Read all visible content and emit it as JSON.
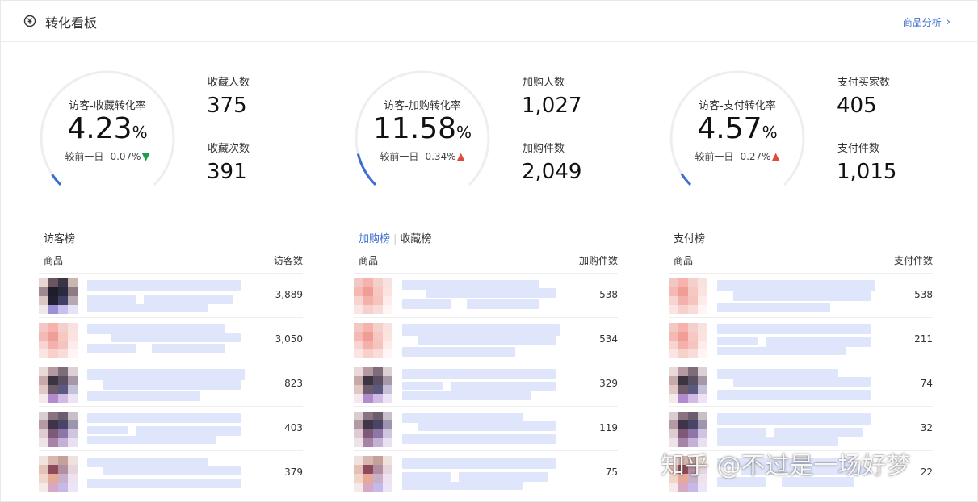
{
  "header": {
    "title": "转化看板",
    "link_label": "商品分析",
    "icon": "yuan-circle-icon"
  },
  "sections": [
    {
      "gauge_label": "访客-收藏转化率",
      "rate": "4.23",
      "rate_unit": "%",
      "rate_fraction": 0.0423,
      "compare_label": "较前一日",
      "compare_value": "0.07%",
      "trend": "down",
      "stat1_label": "收藏人数",
      "stat1_value": "375",
      "stat2_label": "收藏次数",
      "stat2_value": "391",
      "tabs": [
        "访客榜"
      ],
      "col_product": "商品",
      "col_metric": "访客数",
      "rows": [
        "3,889",
        "3,050",
        "823",
        "403",
        "379"
      ]
    },
    {
      "gauge_label": "访客-加购转化率",
      "rate": "11.58",
      "rate_unit": "%",
      "rate_fraction": 0.1158,
      "compare_label": "较前一日",
      "compare_value": "0.34%",
      "trend": "up",
      "stat1_label": "加购人数",
      "stat1_value": "1,027",
      "stat2_label": "加购件数",
      "stat2_value": "2,049",
      "tabs": [
        "加购榜",
        "收藏榜"
      ],
      "col_product": "商品",
      "col_metric": "加购件数",
      "rows": [
        "538",
        "534",
        "329",
        "119",
        "75"
      ]
    },
    {
      "gauge_label": "访客-支付转化率",
      "rate": "4.57",
      "rate_unit": "%",
      "rate_fraction": 0.0457,
      "compare_label": "较前一日",
      "compare_value": "0.27%",
      "trend": "up",
      "stat1_label": "支付买家数",
      "stat1_value": "405",
      "stat2_label": "支付件数",
      "stat2_value": "1,015",
      "tabs": [
        "支付榜"
      ],
      "col_product": "商品",
      "col_metric": "支付件数",
      "rows": [
        "538",
        "211",
        "74",
        "32",
        "22"
      ]
    }
  ],
  "watermark": "知乎 @不过是一场好梦",
  "colors": {
    "accent": "#3a6fd0",
    "up": "#e04a3b",
    "down": "#1a9e4b",
    "track": "#eeeeee"
  }
}
